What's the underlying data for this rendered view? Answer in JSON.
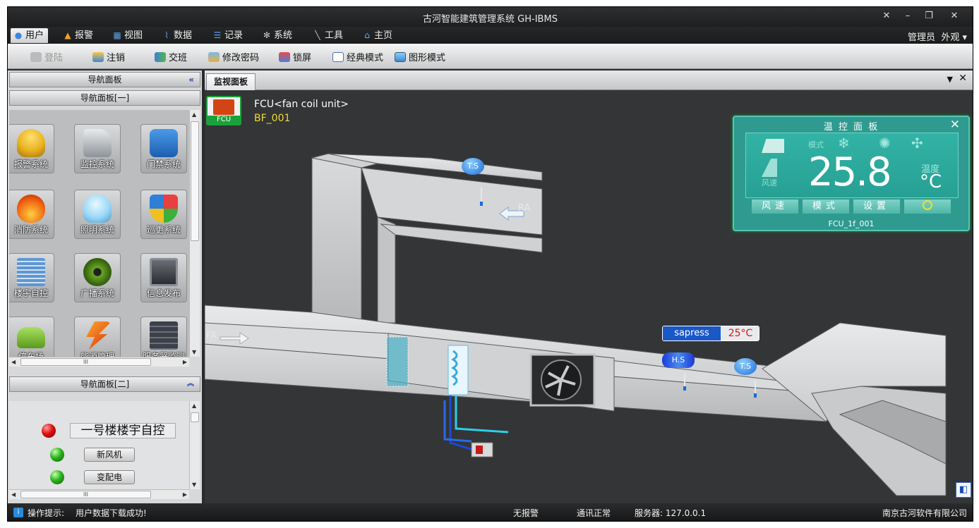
{
  "window": {
    "title": "古河智能建筑管理系统  GH-IBMS"
  },
  "menu": [
    {
      "label": "用户",
      "icon": "user-icon",
      "color": "#3a86e0"
    },
    {
      "label": "报警",
      "icon": "bell-icon",
      "color": "#f2a21c"
    },
    {
      "label": "视图",
      "icon": "grid-icon",
      "color": "#5aa0e6"
    },
    {
      "label": "数据",
      "icon": "chart-icon",
      "color": "#5aa0e6"
    },
    {
      "label": "记录",
      "icon": "list-icon",
      "color": "#5aa0e6"
    },
    {
      "label": "系统",
      "icon": "gear-icon",
      "color": "#c8c8c8"
    },
    {
      "label": "工具",
      "icon": "wrench-icon",
      "color": "#c8c8c8"
    },
    {
      "label": "主页",
      "icon": "home-icon",
      "color": "#6ab0f0"
    }
  ],
  "user": {
    "role": "管理员",
    "appearance": "外观"
  },
  "toolbar": [
    {
      "label": "登陆",
      "icon": "login-icon",
      "enabled": false
    },
    {
      "label": "注销",
      "icon": "logout-icon",
      "enabled": true
    },
    {
      "label": "交班",
      "icon": "handover-icon",
      "enabled": true
    },
    {
      "label": "修改密码",
      "icon": "password-icon",
      "enabled": true
    },
    {
      "label": "锁屏",
      "icon": "lock-icon",
      "enabled": true
    },
    {
      "label": "经典模式",
      "icon": "classic-mode-icon",
      "enabled": true
    },
    {
      "label": "图形模式",
      "icon": "graphic-mode-icon",
      "enabled": true
    }
  ],
  "nav": {
    "panel_title": "导航面板",
    "group1": {
      "title": "导航面板[一]",
      "items": [
        {
          "label": "报警系统",
          "icon": "bell-icon",
          "color": "#e8b21e"
        },
        {
          "label": "监控系统",
          "icon": "camera-icon",
          "color": "#8e9398"
        },
        {
          "label": "门禁系统",
          "icon": "id-card-icon",
          "color": "#2c7ad0"
        },
        {
          "label": "消防系统",
          "icon": "fire-icon",
          "color": "#f06010"
        },
        {
          "label": "照明系统",
          "icon": "bulb-icon",
          "color": "#9ad8f8"
        },
        {
          "label": "巡更系统",
          "icon": "shield-icon",
          "color": "#2d7fd8"
        },
        {
          "label": "楼宇自控",
          "icon": "building-icon",
          "color": "#5f96d2"
        },
        {
          "label": "广播系统",
          "icon": "speaker-icon",
          "color": "#6aa624"
        },
        {
          "label": "信息发布",
          "icon": "display-icon",
          "color": "#4a4e56"
        },
        {
          "label": "停车场",
          "icon": "car-icon",
          "color": "#7cc232"
        },
        {
          "label": "能源管理",
          "icon": "energy-icon",
          "color": "#e86018"
        },
        {
          "label": "服务器监测",
          "icon": "server-icon",
          "color": "#3c4048"
        }
      ]
    },
    "group2": {
      "title": "导航面板[二]",
      "header": "一号楼楼宇自控",
      "items": [
        "新风机",
        "变配电"
      ]
    }
  },
  "main": {
    "tab_label": "监视面板",
    "fcu": {
      "badge": "FCU",
      "name": "FCU<fan coil unit>",
      "id": "BF_001"
    },
    "labels": {
      "ra": "RA",
      "fa": "FA",
      "ts": "T.S",
      "hs": "H.S"
    },
    "pressure": {
      "label": "sapress",
      "value": "25°C"
    },
    "thermostat": {
      "title": "温 控 面 板",
      "mode_label": "模式",
      "temp_label": "温度",
      "fan_label": "风速",
      "temperature": "25.8",
      "unit": "°C",
      "buttons": [
        "风速",
        "模式",
        "设置"
      ],
      "power_icon": "power-icon",
      "device": "FCU_1f_001"
    }
  },
  "status": {
    "hint_label": "操作提示:",
    "hint": "用户数据下载成功!",
    "alarm": "无报警",
    "comm": "通讯正常",
    "server": "服务器: 127.0.0.1",
    "company": "南京古河软件有限公司"
  }
}
